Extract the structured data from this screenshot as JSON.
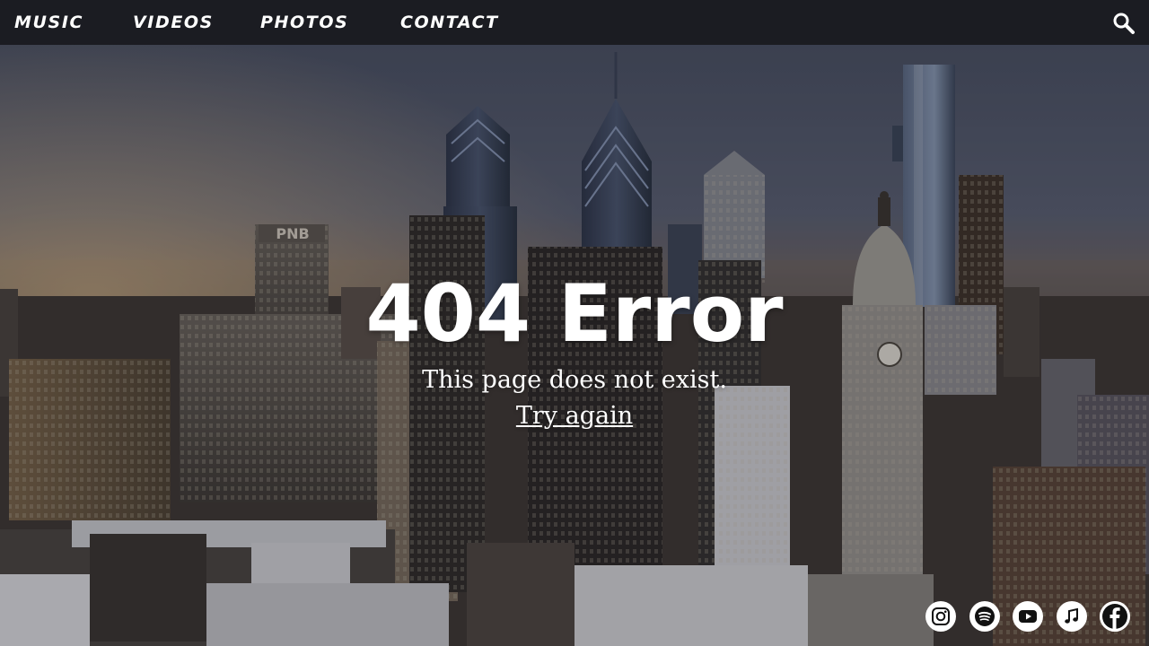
{
  "nav": {
    "items": [
      {
        "label": "MUSIC"
      },
      {
        "label": "VIDEOS"
      },
      {
        "label": "PHOTOS"
      },
      {
        "label": "CONTACT"
      }
    ],
    "search_icon": "search-icon"
  },
  "hero": {
    "background": "city-skyline-photo"
  },
  "error": {
    "title": "404 Error",
    "message": "This page does not exist.",
    "link": "Try again"
  },
  "social": [
    {
      "icon": "instagram-icon"
    },
    {
      "icon": "spotify-icon"
    },
    {
      "icon": "youtube-icon"
    },
    {
      "icon": "apple-music-icon"
    },
    {
      "icon": "facebook-icon"
    }
  ],
  "colors": {
    "nav_bg": "#1b1c22",
    "text": "#ffffff"
  }
}
